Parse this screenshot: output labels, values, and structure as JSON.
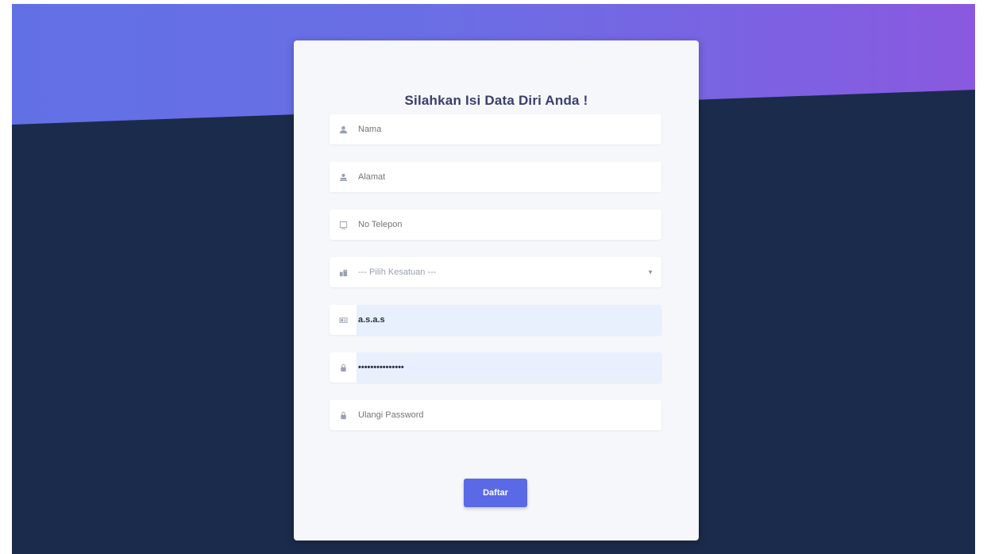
{
  "page": {
    "background_color": "#1b2b4b",
    "gradient_start": "#6270e6",
    "gradient_end": "#8a59e0",
    "accent": "#5a6ae6"
  },
  "form": {
    "title": "Silahkan Isi Data Diri Anda !",
    "fields": {
      "nama": {
        "placeholder": "Nama",
        "value": "",
        "icon": "user-icon"
      },
      "alamat": {
        "placeholder": "Alamat",
        "value": "",
        "icon": "address-icon"
      },
      "telepon": {
        "placeholder": "No Telepon",
        "value": "",
        "icon": "phone-icon"
      },
      "kesatuan": {
        "selected": "--- Pilih Kesatuan ---",
        "icon": "building-icon"
      },
      "username": {
        "value": "a.s.a.s",
        "icon": "id-card-icon"
      },
      "password": {
        "value": "•••••••••••••••",
        "icon": "lock-icon"
      },
      "ulangi_password": {
        "placeholder": "Ulangi Password",
        "value": "",
        "icon": "lock-icon"
      }
    },
    "submit_label": "Daftar"
  }
}
